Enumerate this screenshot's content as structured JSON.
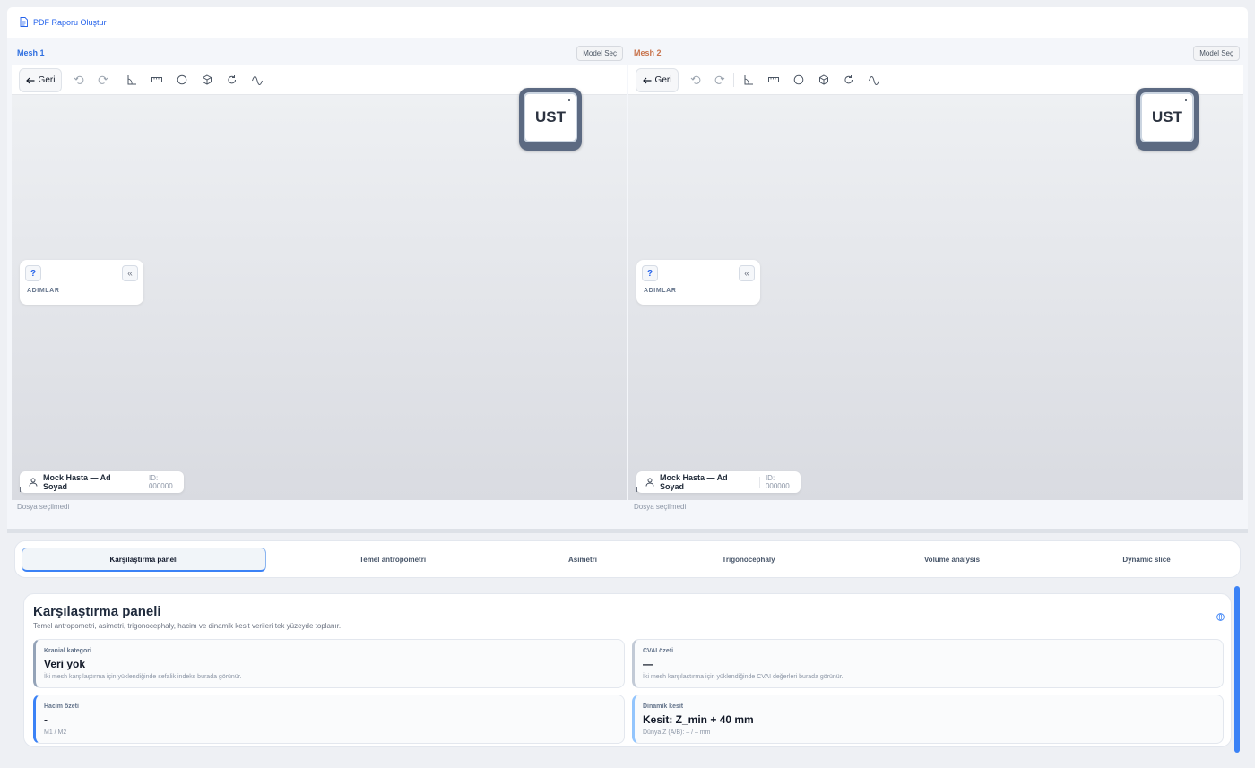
{
  "topbar": {
    "pdf_label": "PDF Raporu Oluştur"
  },
  "panes": [
    {
      "title": "Mesh 1",
      "model_button": "Model Seç",
      "back_label": "Geri",
      "cube_label": "UST",
      "steps_label": "ADIMLAR",
      "help_label": "?",
      "collapse_label": "«",
      "patient_name": "Mock Hasta — Ad Soyad",
      "patient_id": "ID: 000000",
      "file_status": "Dosya seçilmedi"
    },
    {
      "title": "Mesh 2",
      "model_button": "Model Seç",
      "back_label": "Geri",
      "cube_label": "UST",
      "steps_label": "ADIMLAR",
      "help_label": "?",
      "collapse_label": "«",
      "patient_name": "Mock Hasta — Ad Soyad",
      "patient_id": "ID: 000000",
      "file_status": "Dosya seçilmedi"
    }
  ],
  "tools": [
    "undo-icon",
    "redo-icon",
    "angle-icon",
    "ruler-icon",
    "circle-icon",
    "cube-icon",
    "rotate-icon",
    "curve-icon"
  ],
  "tabs": [
    {
      "label": "Karşılaştırma paneli",
      "active": true
    },
    {
      "label": "Temel antropometri",
      "active": false
    },
    {
      "label": "Asimetri",
      "active": false
    },
    {
      "label": "Trigonocephaly",
      "active": false
    },
    {
      "label": "Volume analysis",
      "active": false
    },
    {
      "label": "Dynamic slice",
      "active": false
    }
  ],
  "panel": {
    "title": "Karşılaştırma paneli",
    "subtitle": "Temel antropometri, asimetri, trigonocephaly, hacim ve dinamik kesit verileri tek yüzeyde toplanır.",
    "cards": [
      {
        "label": "Kranial kategori",
        "value": "Veri yok",
        "note": "İki mesh karşılaştırma için yüklendiğinde sefalik indeks burada görünür."
      },
      {
        "label": "CVAI özeti",
        "value": "—",
        "note": "İki mesh karşılaştırma için yüklendiğinde CVAI değerleri burada görünür."
      },
      {
        "label": "Hacim özeti",
        "value": "-",
        "note": "M1 / M2"
      },
      {
        "label": "Dinamik kesit",
        "value": "Kesit: Z_min + 40 mm",
        "note": "Dünya Z (A/B): – / – mm"
      }
    ]
  },
  "colors": {
    "mesh1": "#2f6fe0",
    "mesh2": "#c8734c",
    "accent": "#3b82f6"
  }
}
